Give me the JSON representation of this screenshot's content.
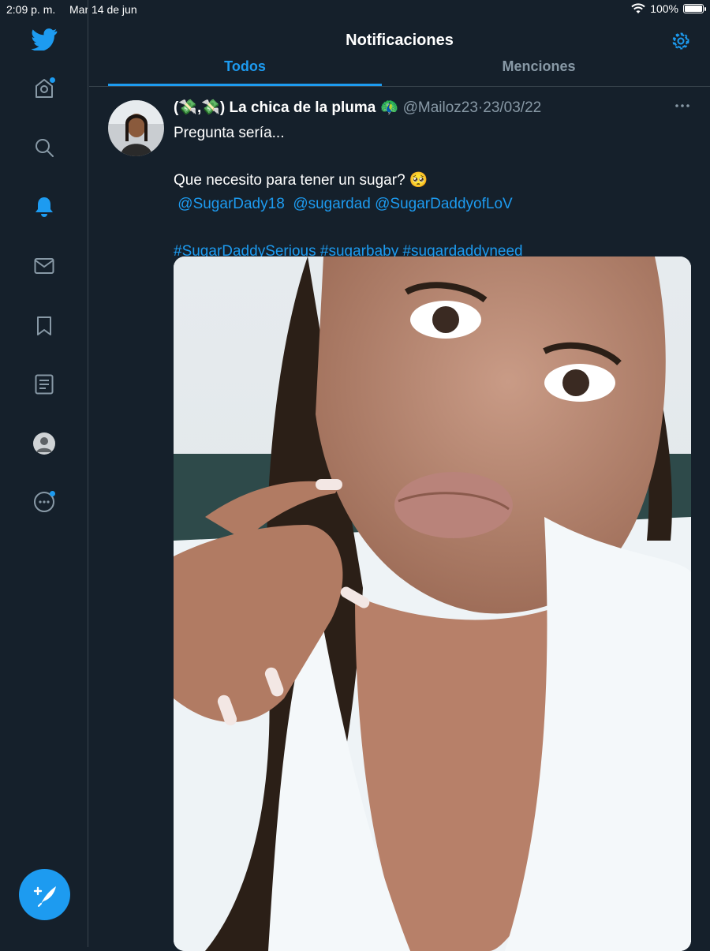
{
  "status_bar": {
    "time": "2:09 p. m.",
    "date": "Mar 14 de jun",
    "battery": "100%"
  },
  "header": {
    "title": "Notificaciones",
    "tabs": [
      {
        "label": "Todos"
      },
      {
        "label": "Menciones"
      }
    ]
  },
  "sidebar": {
    "items": [
      {
        "icon": "twitter-logo-icon"
      },
      {
        "icon": "home-icon"
      },
      {
        "icon": "search-icon"
      },
      {
        "icon": "bell-icon"
      },
      {
        "icon": "mail-icon"
      },
      {
        "icon": "bookmark-icon"
      },
      {
        "icon": "list-icon"
      },
      {
        "icon": "profile-avatar"
      },
      {
        "icon": "more-icon"
      }
    ],
    "compose_icon": "compose-tweet-icon"
  },
  "tweet": {
    "display_name": "(💸,💸) La chica de la pluma 🦚",
    "handle": "@Mailoz23",
    "separator": "·",
    "date": "23/03/22",
    "lines": [
      {
        "text": "Pregunta sería..."
      },
      {
        "text": ""
      },
      {
        "text": "Que necesito para tener un sugar? 🥺"
      }
    ],
    "mentions": [
      "@SugarDady18",
      "@sugardad",
      "@SugarDaddyofLoV"
    ],
    "hashtags": [
      "#SugarDaddySerious",
      "#sugarbaby",
      "#sugardaddyneed"
    ]
  },
  "colors": {
    "background": "#15202b",
    "accent": "#1d9bf0",
    "secondary_text": "#8899a6",
    "divider": "#38444d"
  }
}
